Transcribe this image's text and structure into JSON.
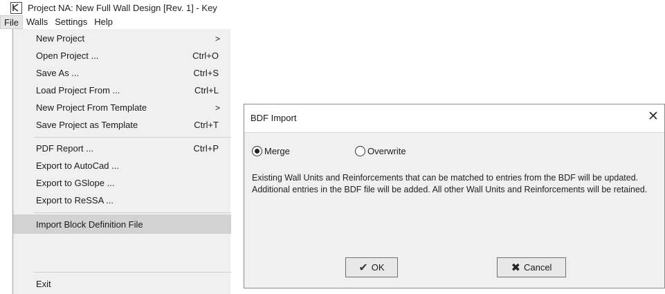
{
  "window": {
    "title": "Project NA: New Full Wall Design [Rev. 1] - Key"
  },
  "menubar": {
    "items": [
      {
        "label": "File"
      },
      {
        "label": "Walls"
      },
      {
        "label": "Settings"
      },
      {
        "label": "Help"
      }
    ]
  },
  "file_menu": {
    "items": [
      {
        "label": "New Project",
        "shortcut": "",
        "submenu": true
      },
      {
        "label": "Open Project ...",
        "shortcut": "Ctrl+O"
      },
      {
        "label": "Save As ...",
        "shortcut": "Ctrl+S"
      },
      {
        "label": "Load Project From ...",
        "shortcut": "Ctrl+L"
      },
      {
        "label": "New Project From Template",
        "shortcut": "",
        "submenu": true
      },
      {
        "label": "Save Project as Template",
        "shortcut": "Ctrl+T"
      },
      {
        "label": "PDF Report ...",
        "shortcut": "Ctrl+P"
      },
      {
        "label": "Export to AutoCad ..."
      },
      {
        "label": "Export to GSlope ..."
      },
      {
        "label": "Export to ReSSA ..."
      },
      {
        "label": "Import Block Definition File"
      },
      {
        "label": "Exit"
      }
    ],
    "submenu_arrow": ">"
  },
  "dialog": {
    "title": "BDF Import",
    "close_glyph": "✕",
    "options": {
      "merge_label": "Merge",
      "overwrite_label": "Overwrite",
      "selected": "Merge"
    },
    "description": "Existing Wall Units and Reinforcements that can be matched to entries from the BDF will be updated. Additional entries in the BDF file will be added. All other Wall Units and Reinforcements will be retained.",
    "ok_label": "OK",
    "cancel_label": "Cancel"
  }
}
